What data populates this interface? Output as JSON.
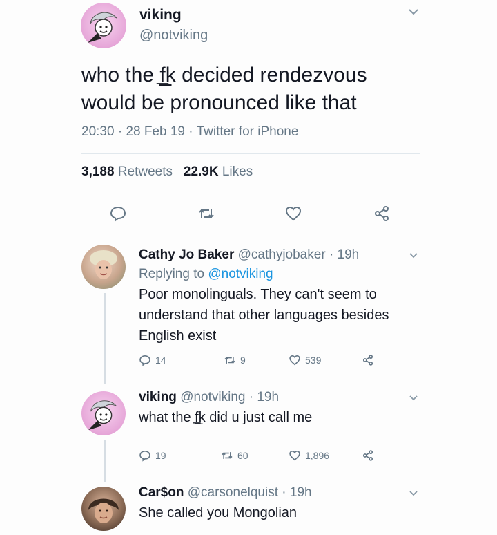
{
  "main_tweet": {
    "name": "viking",
    "handle": "@notviking",
    "text": "who the f̲̲̲k decided rendezvous would be pronounced like that",
    "time": "20:30",
    "date": "28 Feb 19",
    "source": "Twitter for iPhone",
    "retweets_count": "3,188",
    "retweets_label": "Retweets",
    "likes_count": "22.9K",
    "likes_label": "Likes"
  },
  "replies": [
    {
      "name": "Cathy Jo Baker",
      "handle": "@cathyjobaker",
      "time": "19h",
      "replying_prefix": "Replying to",
      "replying_to": "@notviking",
      "text": "Poor monolinguals. They can't seem to understand that other languages besides English exist",
      "replies": "14",
      "retweets": "9",
      "likes": "539"
    },
    {
      "name": "viking",
      "handle": "@notviking",
      "time": "19h",
      "text": "what the f̲̲̲k did u just call me",
      "replies": "19",
      "retweets": "60",
      "likes": "1,896"
    },
    {
      "name": "Car$on",
      "handle": "@carsonelquist",
      "time": "19h",
      "text": "She called you Mongolian"
    }
  ],
  "separator": "·",
  "icons": [
    "chevron-down-icon",
    "reply-icon",
    "retweet-icon",
    "like-icon",
    "share-icon"
  ],
  "colors": {
    "text": "#141823",
    "secondary": "#657786",
    "link": "#1b95e0",
    "border": "#e1e8ed"
  }
}
